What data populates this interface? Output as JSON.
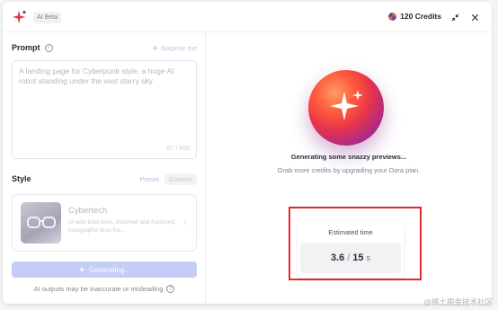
{
  "header": {
    "beta_label": "AI Beta",
    "credits_label": "120 Credits"
  },
  "prompt": {
    "label": "Prompt",
    "surprise_label": "Surprise me",
    "placeholder": "A landing page for Cyberpunk style, a huge AI robot standing under the vast starry sky",
    "char_count": "87 / 500"
  },
  "style": {
    "label": "Style",
    "tabs": [
      "Preset",
      "Custom"
    ],
    "selected": {
      "title": "Cybertech",
      "description": "UI with bold lines, distorted and fractured, holographic lens-fus..."
    }
  },
  "generate_button": {
    "label": "Generating..."
  },
  "disclaimer": "AI outputs may be inaccurate or misleading",
  "status": {
    "title": "Generating some snazzy previews...",
    "subtitle": "Grab more credits by upgrading your Dora plan."
  },
  "estimated": {
    "label": "Estimated time",
    "current": "3.6",
    "separator": "/",
    "total": "15",
    "unit": "s"
  },
  "watermark": "@稀土掘金技术社区",
  "colors": {
    "accent_light": "#c3cdf6",
    "highlight": "#e0292f",
    "orb_orange": "#ff5a3c",
    "orb_purple": "#4a2fd0"
  }
}
